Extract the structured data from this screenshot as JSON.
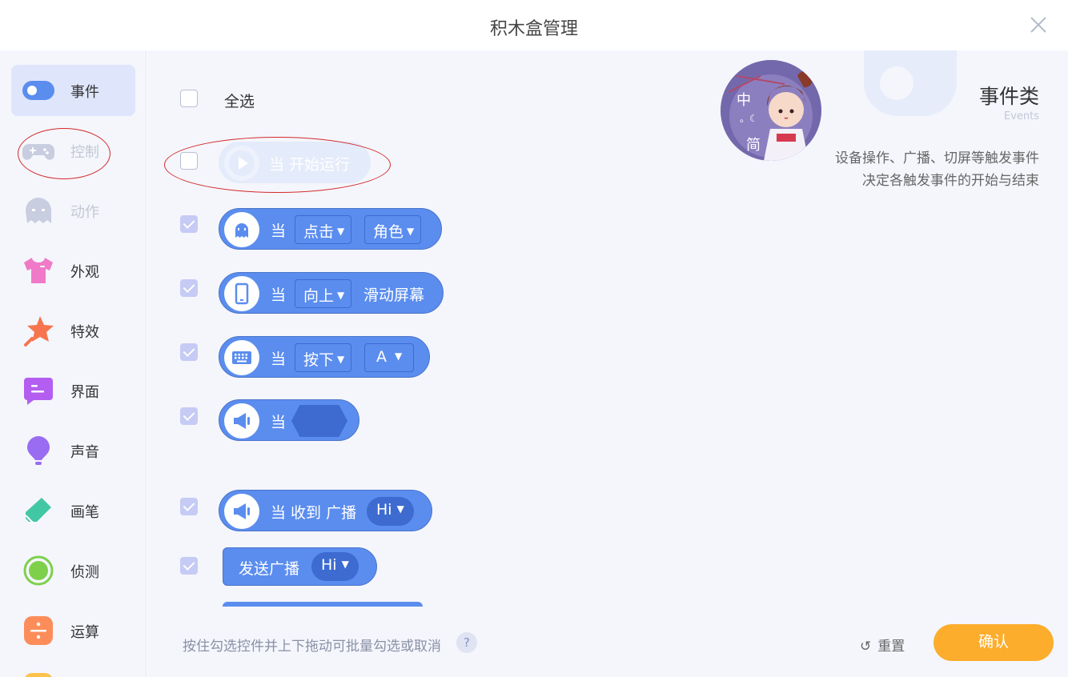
{
  "header": {
    "title": "积木盒管理",
    "close_icon": "close-icon"
  },
  "sidebar": {
    "items": [
      {
        "label": "事件",
        "icon": "toggle-icon",
        "color": "#5b8def",
        "active": true
      },
      {
        "label": "控制",
        "icon": "gamepad-icon",
        "color": "#c8cde0",
        "disabled": true
      },
      {
        "label": "动作",
        "icon": "ghost-icon",
        "color": "#c8cde0",
        "disabled": true
      },
      {
        "label": "外观",
        "icon": "shirt-icon",
        "color": "#f07ac8"
      },
      {
        "label": "特效",
        "icon": "star-icon",
        "color": "#f7754e"
      },
      {
        "label": "界面",
        "icon": "chat-icon",
        "color": "#b35ef0"
      },
      {
        "label": "声音",
        "icon": "bulb-icon",
        "color": "#9a6cf2"
      },
      {
        "label": "画笔",
        "icon": "eraser-icon",
        "color": "#42c7a4"
      },
      {
        "label": "侦测",
        "icon": "target-icon",
        "color": "#7ed04b"
      },
      {
        "label": "运算",
        "icon": "divide-icon",
        "color": "#fc8d5b"
      }
    ]
  },
  "main": {
    "select_all": "全选",
    "blocks": [
      {
        "label": "当 开始运行",
        "icon": "play-icon",
        "checked": false,
        "faded": true
      },
      {
        "when": "当",
        "icon": "ghost-icon",
        "dd1": "点击",
        "dd2": "角色",
        "checked": true
      },
      {
        "when": "当",
        "icon": "phone-icon",
        "dd1": "向上",
        "tail": "滑动屏幕",
        "checked": true
      },
      {
        "when": "当",
        "icon": "keyboard-icon",
        "dd1": "按下",
        "dd2": "A",
        "checked": true
      },
      {
        "when": "当",
        "icon": "megaphone-icon",
        "checked": true
      },
      {
        "label": "当 收到 广播",
        "icon": "megaphone-icon",
        "value": "Hi",
        "checked": true
      },
      {
        "label": "发送广播",
        "value": "Hi",
        "checked": true
      }
    ],
    "hint": "按住勾选控件并上下拖动可批量勾选或取消",
    "help_icon": "?",
    "reset_label": "重置",
    "confirm_label": "确认"
  },
  "info": {
    "title": "事件类",
    "subtitle": "Events",
    "desc_line1": "设备操作、广播、切屏等触发事件",
    "desc_line2": "决定各触发事件的开始与结束",
    "avatar_text": [
      "中",
      "简"
    ]
  },
  "colors": {
    "block": "#5b8def",
    "confirm": "#fdad2c",
    "annotation": "#d42a2a"
  }
}
